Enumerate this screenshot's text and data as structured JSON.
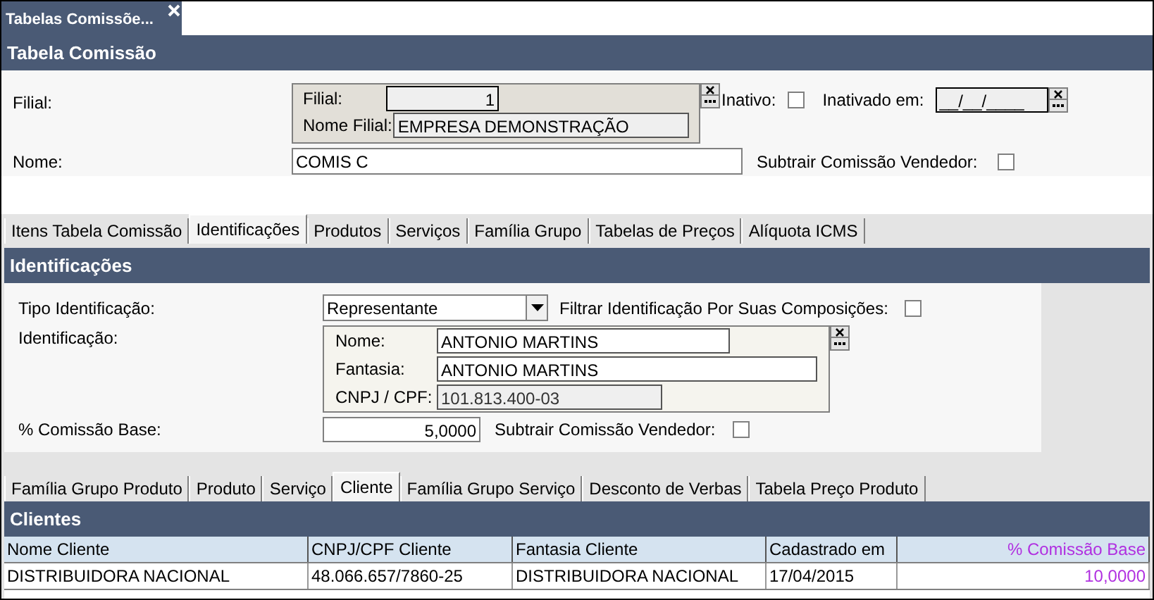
{
  "document_tab": {
    "label": "Tabelas Comissõe...",
    "selected": true
  },
  "header": {
    "title": "Tabela Comissão"
  },
  "form": {
    "filial_label": "Filial:",
    "filial_lookup": {
      "code_label": "Filial:",
      "code_value": "1",
      "name_label": "Nome Filial:",
      "name_value": "EMPRESA DEMONSTRAÇÃO"
    },
    "inativo": {
      "label": "Inativo:",
      "checked": false
    },
    "inativado_em": {
      "label": "Inativado em:",
      "value": "__/__/____"
    },
    "nome": {
      "label": "Nome:",
      "value": "COMIS C"
    },
    "subtrair": {
      "label": "Subtrair Comissão Vendedor:",
      "checked": false
    }
  },
  "tabs": [
    {
      "label": "Itens Tabela Comissão",
      "selected": false
    },
    {
      "label": "Identificações",
      "selected": true
    },
    {
      "label": "Produtos",
      "selected": false
    },
    {
      "label": "Serviços",
      "selected": false
    },
    {
      "label": "Família Grupo",
      "selected": false
    },
    {
      "label": "Tabelas de Preços",
      "selected": false
    },
    {
      "label": "Alíquota ICMS",
      "selected": false
    }
  ],
  "identificacoes": {
    "title": "Identificações",
    "tipo": {
      "label": "Tipo Identificação:",
      "value": "Representante"
    },
    "filtrar": {
      "label": "Filtrar Identificação Por Suas Composições:",
      "checked": false
    },
    "identificacao_label": "Identificação:",
    "lookup": {
      "nome_label": "Nome:",
      "nome_value": "ANTONIO MARTINS",
      "fantasia_label": "Fantasia:",
      "fantasia_value": "ANTONIO MARTINS",
      "cnpj_label": "CNPJ / CPF:",
      "cnpj_value": "101.813.400-03"
    },
    "comissao": {
      "label": "% Comissão Base:",
      "value": "5,0000"
    },
    "subtrair": {
      "label": "Subtrair Comissão Vendedor:",
      "checked": false
    }
  },
  "sub_tabs": [
    {
      "label": "Família Grupo Produto",
      "selected": false
    },
    {
      "label": "Produto",
      "selected": false
    },
    {
      "label": "Serviço",
      "selected": false
    },
    {
      "label": "Cliente",
      "selected": true
    },
    {
      "label": "Família Grupo Serviço",
      "selected": false
    },
    {
      "label": "Desconto de Verbas",
      "selected": false
    },
    {
      "label": "Tabela Preço Produto",
      "selected": false
    }
  ],
  "clientes": {
    "title": "Clientes",
    "columns": [
      "Nome Cliente",
      "CNPJ/CPF Cliente",
      "Fantasia Cliente",
      "Cadastrado em",
      "% Comissão Base"
    ],
    "rows": [
      [
        "DISTRIBUIDORA NACIONAL",
        "48.066.657/7860-25",
        "DISTRIBUIDORA NACIONAL",
        "17/04/2015",
        "10,0000"
      ]
    ]
  }
}
